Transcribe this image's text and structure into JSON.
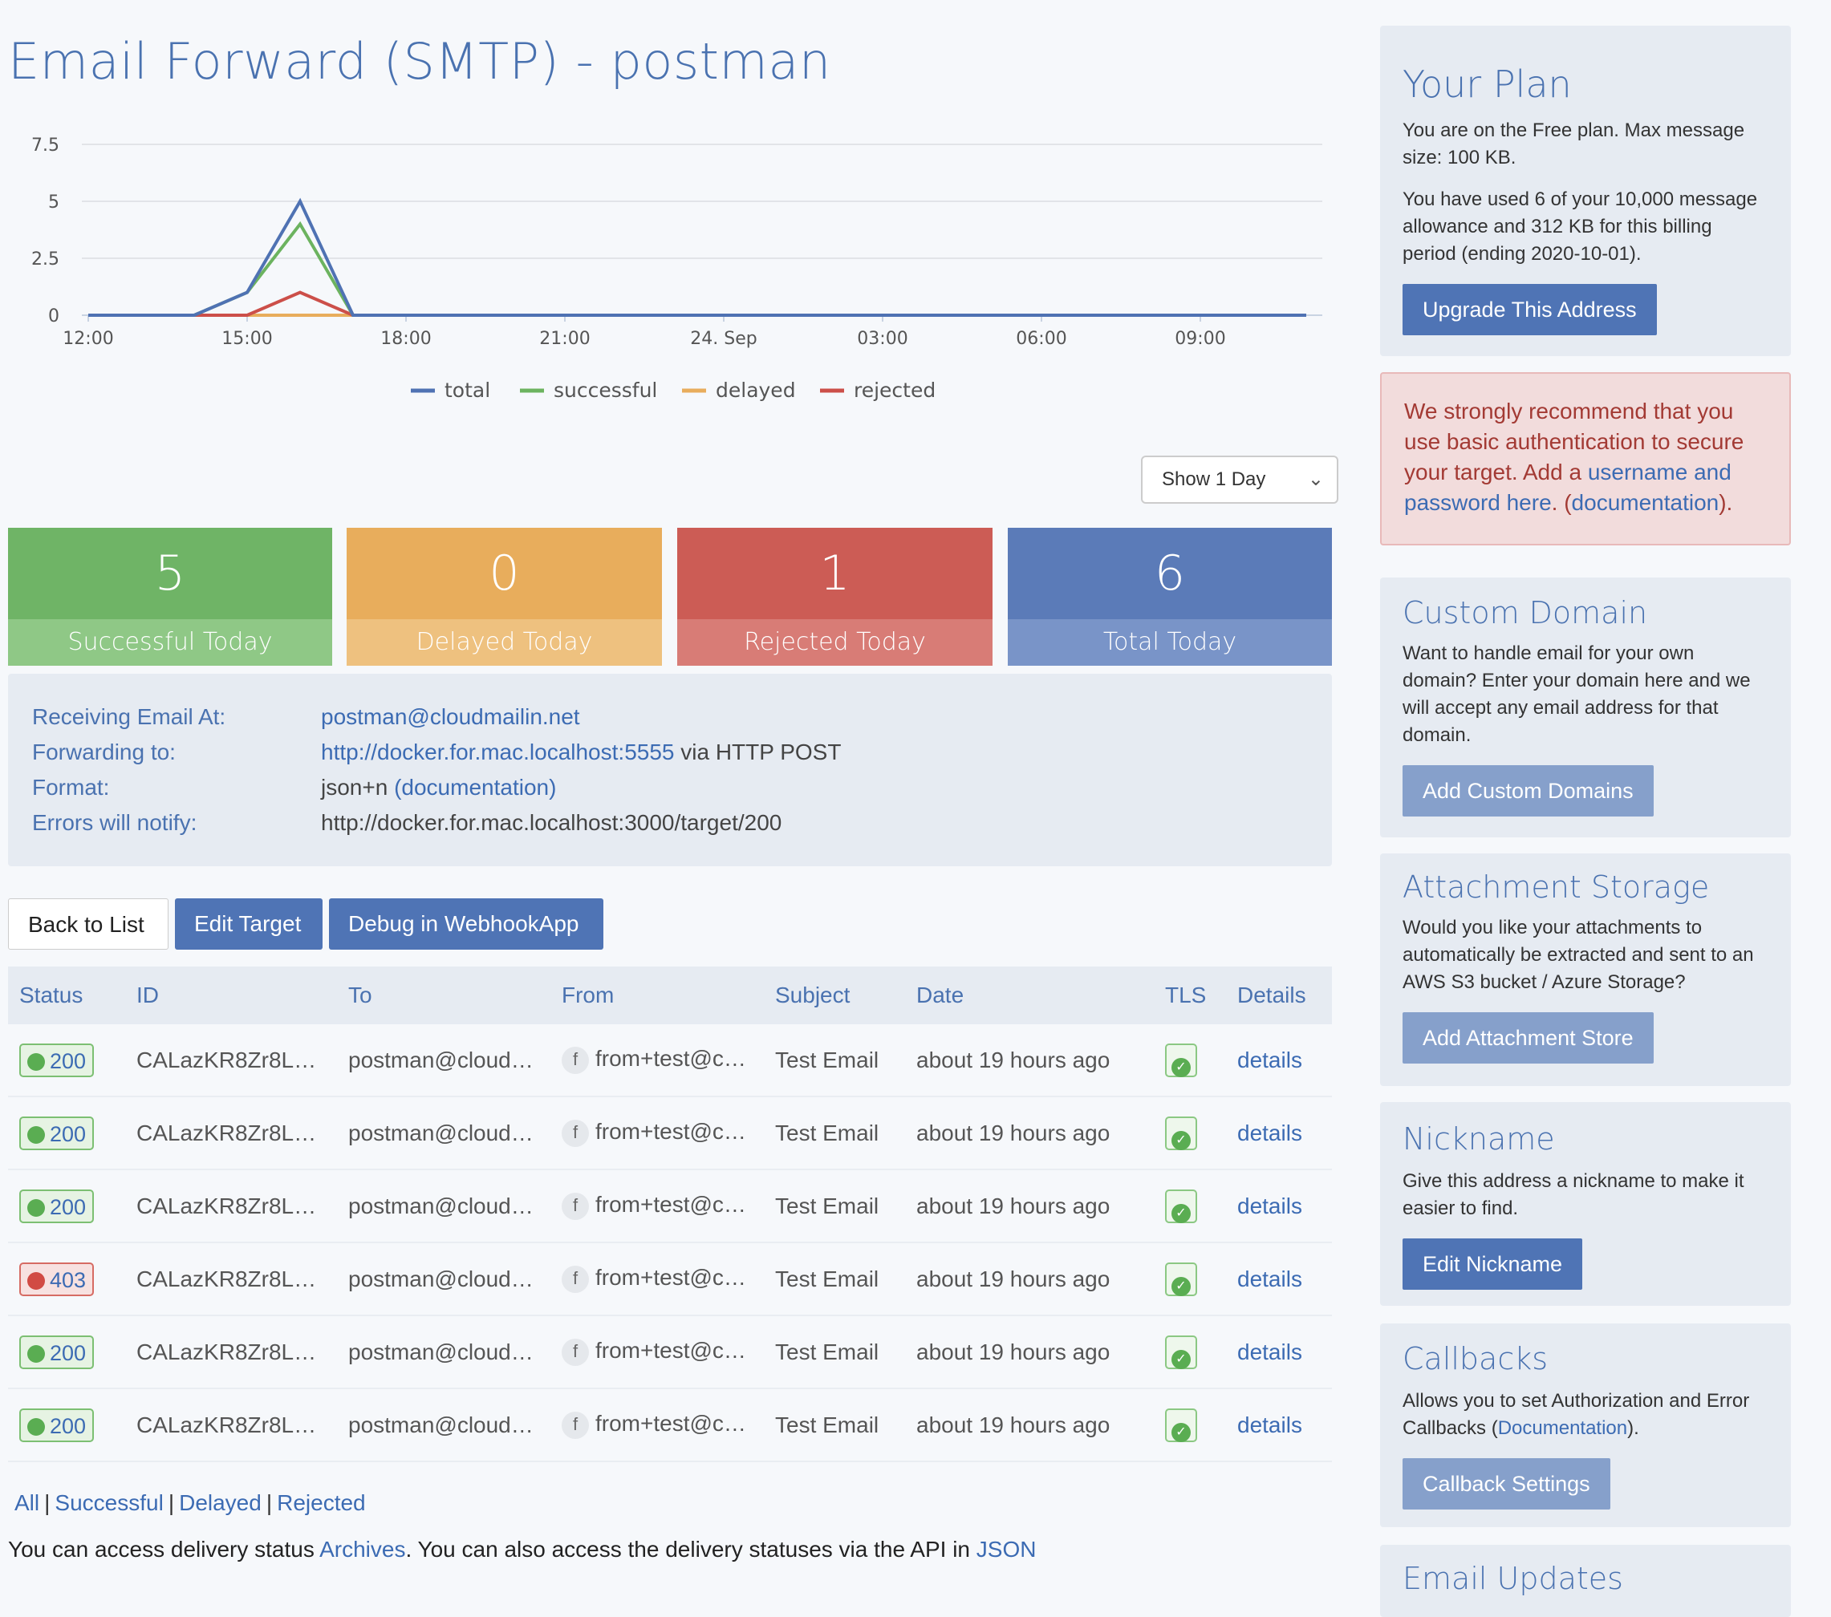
{
  "page": {
    "title": "Email Forward (SMTP) - postman"
  },
  "chart_data": {
    "type": "line",
    "x": [
      "12:00",
      "13:00",
      "14:00",
      "15:00",
      "16:00",
      "17:00",
      "18:00",
      "19:00",
      "20:00",
      "21:00",
      "22:00",
      "23:00",
      "24. Sep",
      "01:00",
      "02:00",
      "03:00",
      "04:00",
      "05:00",
      "06:00",
      "07:00",
      "08:00",
      "09:00",
      "10:00",
      "11:00"
    ],
    "x_tick_labels": [
      "12:00",
      "15:00",
      "18:00",
      "21:00",
      "24. Sep",
      "03:00",
      "06:00",
      "09:00"
    ],
    "y_tick_labels": [
      "0",
      "2.5",
      "5",
      "7.5"
    ],
    "ylim": [
      0,
      7.5
    ],
    "grid": true,
    "legend_position": "bottom",
    "series": [
      {
        "name": "total",
        "color": "#4f72b3",
        "values": [
          0,
          0,
          0,
          1,
          5,
          0,
          0,
          0,
          0,
          0,
          0,
          0,
          0,
          0,
          0,
          0,
          0,
          0,
          0,
          0,
          0,
          0,
          0,
          0
        ]
      },
      {
        "name": "successful",
        "color": "#6cb35f",
        "values": [
          0,
          0,
          0,
          1,
          4,
          0,
          0,
          0,
          0,
          0,
          0,
          0,
          0,
          0,
          0,
          0,
          0,
          0,
          0,
          0,
          0,
          0,
          0,
          0
        ]
      },
      {
        "name": "delayed",
        "color": "#e8ad5c",
        "values": [
          0,
          0,
          0,
          0,
          0,
          0,
          0,
          0,
          0,
          0,
          0,
          0,
          0,
          0,
          0,
          0,
          0,
          0,
          0,
          0,
          0,
          0,
          0,
          0
        ]
      },
      {
        "name": "rejected",
        "color": "#cc4f49",
        "values": [
          0,
          0,
          0,
          0,
          1,
          0,
          0,
          0,
          0,
          0,
          0,
          0,
          0,
          0,
          0,
          0,
          0,
          0,
          0,
          0,
          0,
          0,
          0,
          0
        ]
      }
    ]
  },
  "range_select": {
    "value": "Show 1 Day"
  },
  "stats": [
    {
      "value": "5",
      "label": "Successful Today"
    },
    {
      "value": "0",
      "label": "Delayed Today"
    },
    {
      "value": "1",
      "label": "Rejected Today"
    },
    {
      "value": "6",
      "label": "Total Today"
    }
  ],
  "info": {
    "receiving_label": "Receiving Email At:",
    "receiving_value": "postman@cloudmailin.net",
    "forwarding_label": "Forwarding to:",
    "forwarding_url": "http://docker.for.mac.localhost:5555",
    "forwarding_suffix": " via HTTP POST",
    "format_label": "Format:",
    "format_value": "json+n ",
    "format_link": "(documentation)",
    "errors_label": "Errors will notify:",
    "errors_value": "http://docker.for.mac.localhost:3000/target/200"
  },
  "actions": {
    "back": "Back to List",
    "edit": "Edit Target",
    "debug": "Debug in WebhookApp"
  },
  "table": {
    "headers": [
      "Status",
      "ID",
      "To",
      "From",
      "Subject",
      "Date",
      "TLS",
      "Details"
    ],
    "rows": [
      {
        "status": "200",
        "ok": true,
        "id": "CALazKR8Zr8L…",
        "to": "postman@cloud…",
        "from_icon": "f",
        "from": "from+test@c…",
        "subject": "Test Email",
        "date": "about 19 hours ago",
        "details": "details"
      },
      {
        "status": "200",
        "ok": true,
        "id": "CALazKR8Zr8L…",
        "to": "postman@cloud…",
        "from_icon": "f",
        "from": "from+test@c…",
        "subject": "Test Email",
        "date": "about 19 hours ago",
        "details": "details"
      },
      {
        "status": "200",
        "ok": true,
        "id": "CALazKR8Zr8L…",
        "to": "postman@cloud…",
        "from_icon": "f",
        "from": "from+test@c…",
        "subject": "Test Email",
        "date": "about 19 hours ago",
        "details": "details"
      },
      {
        "status": "403",
        "ok": false,
        "id": "CALazKR8Zr8L…",
        "to": "postman@cloud…",
        "from_icon": "f",
        "from": "from+test@c…",
        "subject": "Test Email",
        "date": "about 19 hours ago",
        "details": "details"
      },
      {
        "status": "200",
        "ok": true,
        "id": "CALazKR8Zr8L…",
        "to": "postman@cloud…",
        "from_icon": "f",
        "from": "from+test@c…",
        "subject": "Test Email",
        "date": "about 19 hours ago",
        "details": "details"
      },
      {
        "status": "200",
        "ok": true,
        "id": "CALazKR8Zr8L…",
        "to": "postman@cloud…",
        "from_icon": "f",
        "from": "from+test@c…",
        "subject": "Test Email",
        "date": "about 19 hours ago",
        "details": "details"
      }
    ]
  },
  "filters": {
    "all": "All",
    "successful": "Successful",
    "delayed": "Delayed",
    "rejected": "Rejected",
    "sep": "|"
  },
  "footer": {
    "t1": "You can access delivery status ",
    "archives": "Archives",
    "t2": ". You can also access the delivery statuses via the API in ",
    "json": "JSON"
  },
  "sidebar": {
    "plan": {
      "title": "Your Plan",
      "p1": "You are on the Free plan. Max message size: 100 KB.",
      "p2": "You have used 6 of your 10,000 message allowance and 312 KB for this billing period (ending 2020-10-01).",
      "button": "Upgrade This Address"
    },
    "alert": {
      "t1": "We strongly recommend that you use basic authentication to secure your target. Add a ",
      "link1": "username and password here",
      "t2": ". (",
      "link2": "documentation",
      "t3": ")."
    },
    "custom_domain": {
      "title": "Custom Domain",
      "text": "Want to handle email for your own domain? Enter your domain here and we will accept any email address for that domain.",
      "button": "Add Custom Domains"
    },
    "attachments": {
      "title": "Attachment Storage",
      "text": "Would you like your attachments to automatically be extracted and sent to an AWS S3 bucket / Azure Storage?",
      "button": "Add Attachment Store"
    },
    "nickname": {
      "title": "Nickname",
      "text": "Give this address a nickname to make it easier to find.",
      "button": "Edit Nickname"
    },
    "callbacks": {
      "t1": "Allows you to set Authorization and Error Callbacks (",
      "link": "Documentation",
      "t2": ").",
      "title": "Callbacks",
      "button": "Callback Settings"
    },
    "updates": {
      "title": "Email Updates"
    }
  }
}
